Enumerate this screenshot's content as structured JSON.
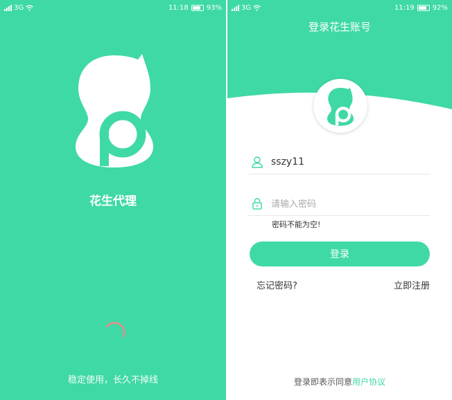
{
  "colors": {
    "brand": "#3fd9a6",
    "white": "#ffffff"
  },
  "splash": {
    "status": {
      "network": "3G",
      "time": "11:18",
      "battery": "93%"
    },
    "app_name": "花生代理",
    "slogan": "稳定使用，长久不掉线"
  },
  "login": {
    "status": {
      "network": "3G",
      "time": "11:19",
      "battery": "92%"
    },
    "title": "登录花生账号",
    "username_value": "sszy11",
    "password_placeholder": "请输入密码",
    "password_error": "密码不能为空!",
    "login_button": "登录",
    "forgot_password": "忘记密码?",
    "register": "立即注册",
    "agreement_prefix": "登录即表示同意",
    "agreement_link": "用户协议"
  },
  "icons": {
    "user": "user-icon",
    "lock": "lock-icon",
    "signal": "signal-icon",
    "wifi": "wifi-icon",
    "battery": "battery-icon",
    "logo": "peanut-logo-icon"
  }
}
